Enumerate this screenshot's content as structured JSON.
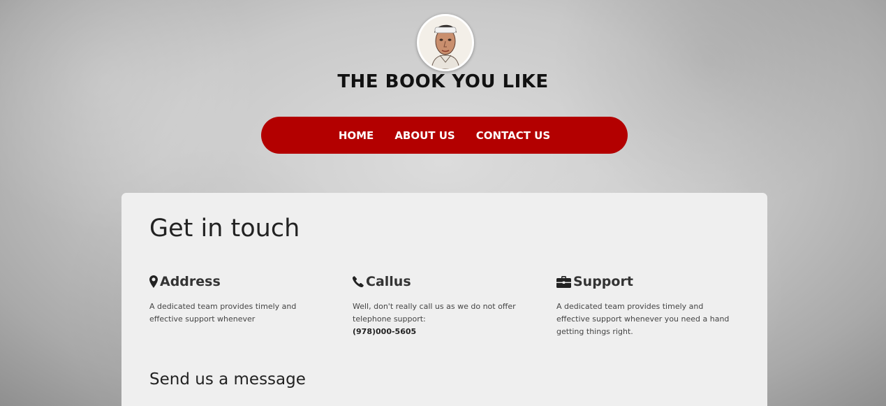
{
  "header": {
    "site_title": "THE BOOK YOU LIKE",
    "logo_icon": "portrait-avatar-icon"
  },
  "nav": {
    "items": [
      {
        "label": "HOME"
      },
      {
        "label": "ABOUT US"
      },
      {
        "label": "CONTACT US"
      }
    ],
    "color": "#b30000"
  },
  "contact": {
    "heading": "Get in touch",
    "columns": [
      {
        "icon": "map-marker-icon",
        "title": "Address",
        "text": "A dedicated team provides timely and effective support whenever"
      },
      {
        "icon": "phone-icon",
        "title": "Callus",
        "text": "Well, don't really call us as we do not offer telephone support:",
        "phone": "(978)000-5605"
      },
      {
        "icon": "briefcase-icon",
        "title": "Support",
        "text": "A dedicated team provides timely and effective support whenever you need a hand getting things right."
      }
    ],
    "form_heading": "Send us a message"
  }
}
